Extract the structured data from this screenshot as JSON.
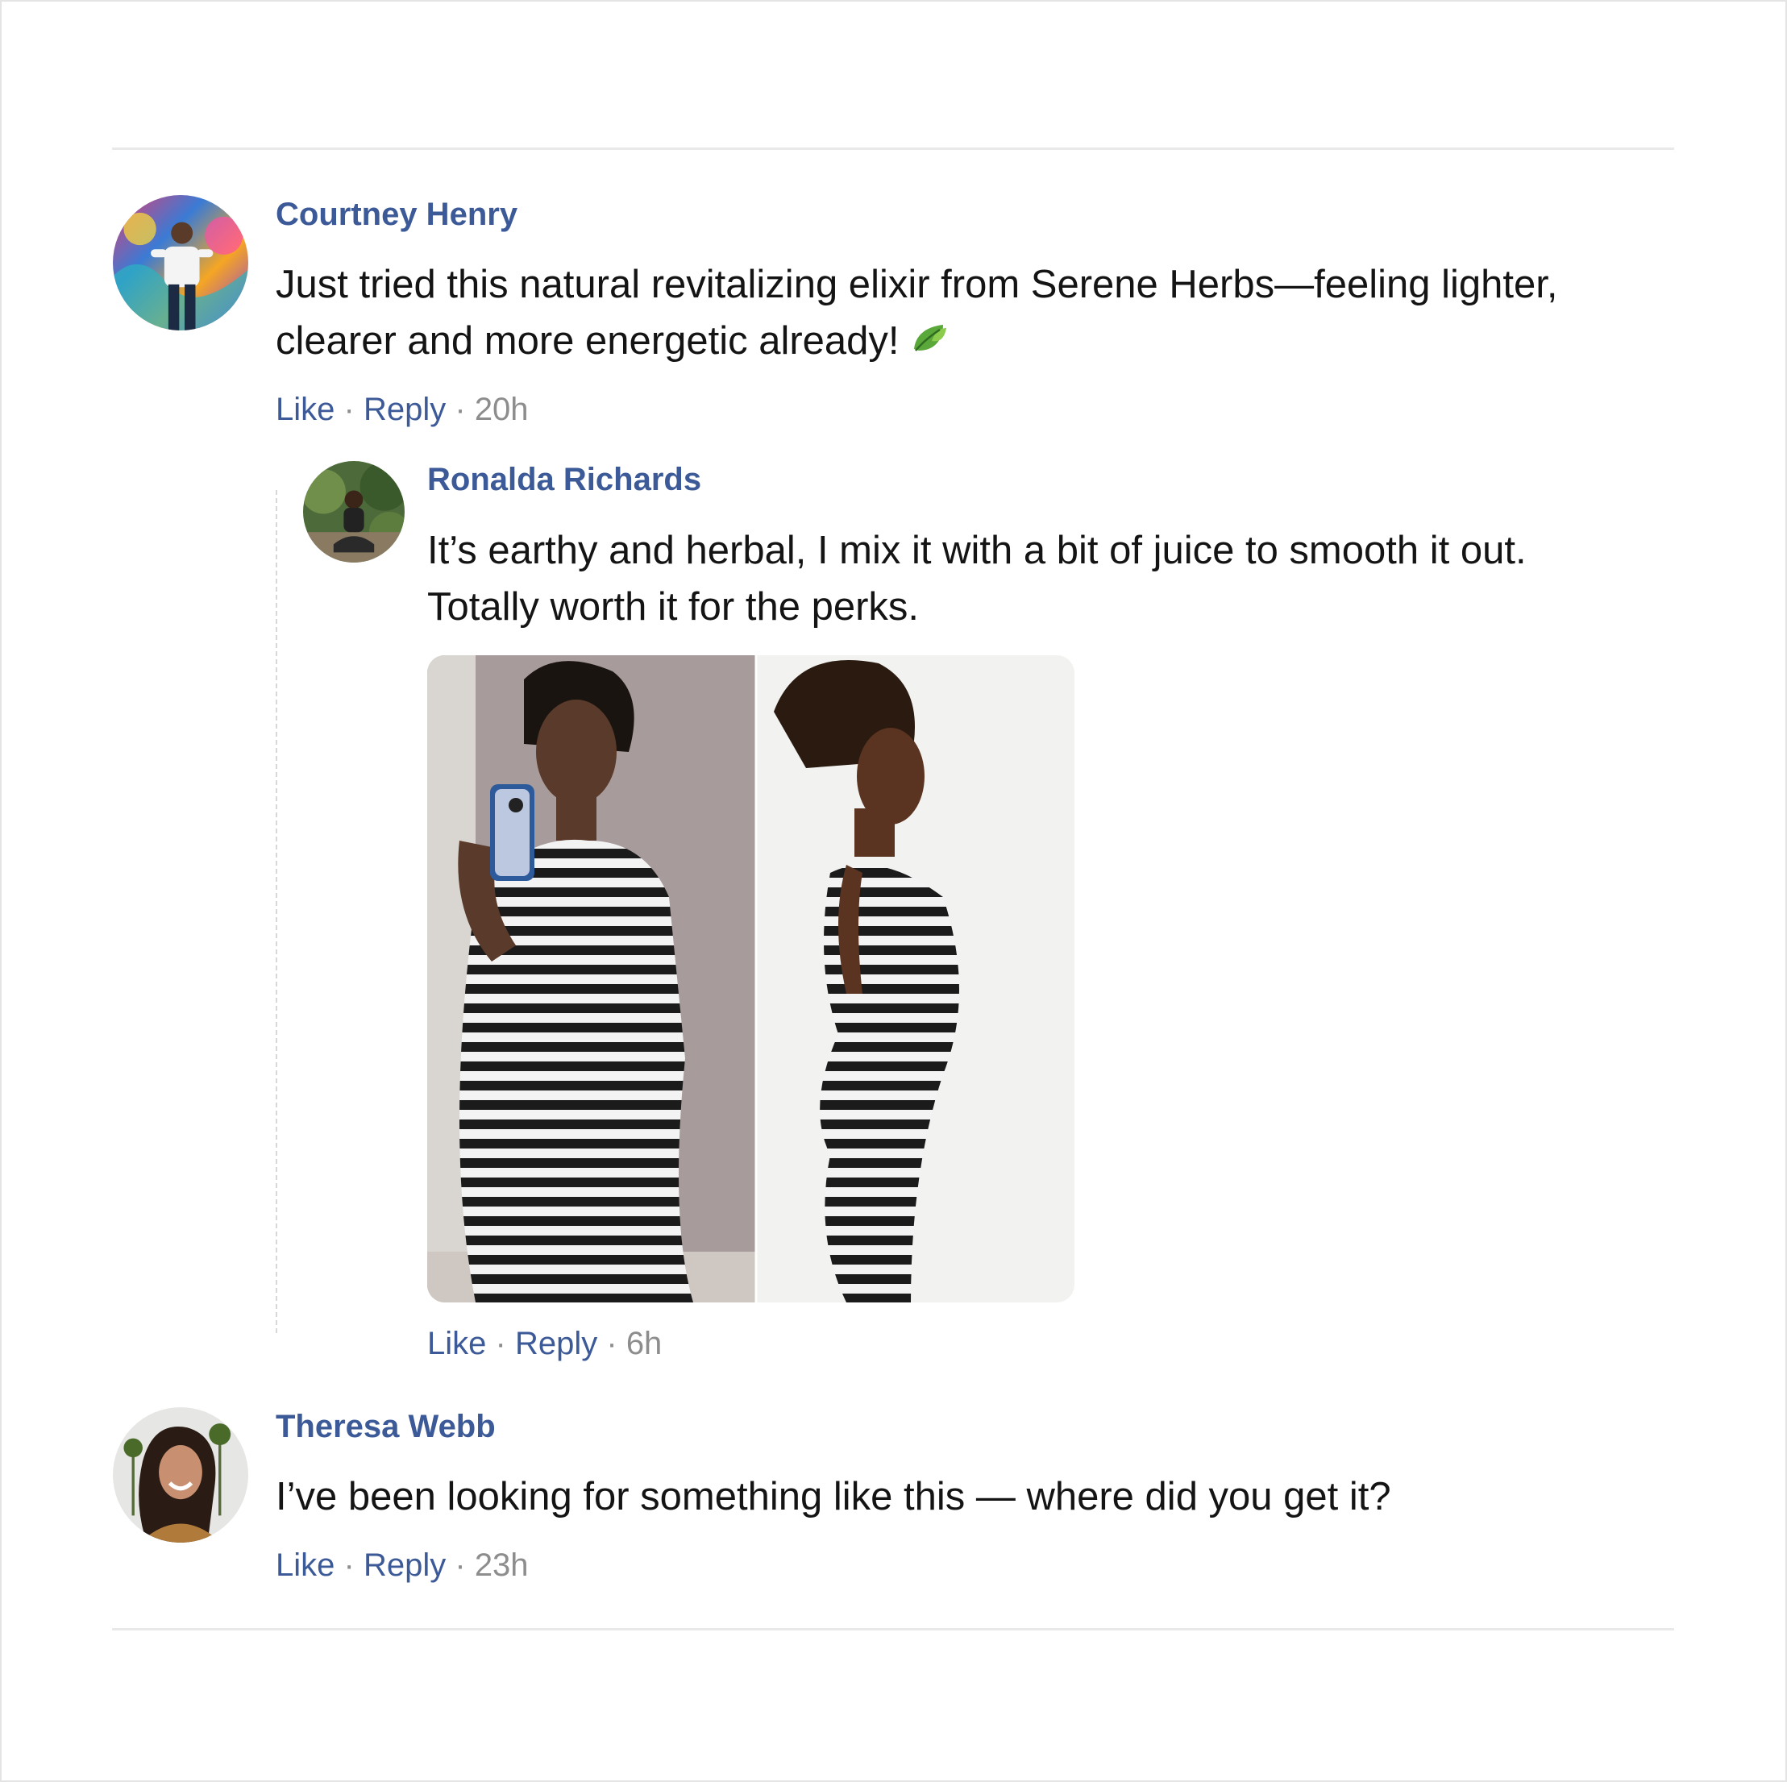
{
  "comments": [
    {
      "author": "Courtney Henry",
      "text_line1": "Just tried this natural revitalizing elixir from Serene Herbs—feeling lighter,",
      "text_line2": "clearer and more energetic already!",
      "emoji": "leaf-icon",
      "like_label": "Like",
      "reply_label": "Reply",
      "time": "20h"
    },
    {
      "author": "Ronalda Richards",
      "text_line1": "It’s earthy and herbal, I mix it with a bit of juice to smooth it out.",
      "text_line2": "Totally worth it for the perks.",
      "like_label": "Like",
      "reply_label": "Reply",
      "time": "6h"
    },
    {
      "author": "Theresa Webb",
      "text_line1": "I’ve been looking for something like this — where did you get it?",
      "like_label": "Like",
      "reply_label": "Reply",
      "time": "23h"
    }
  ],
  "separator": "·",
  "colors": {
    "link": "#3d5a98",
    "text": "#141414",
    "muted": "#8d8d8d",
    "divider": "#e9e9e9"
  }
}
